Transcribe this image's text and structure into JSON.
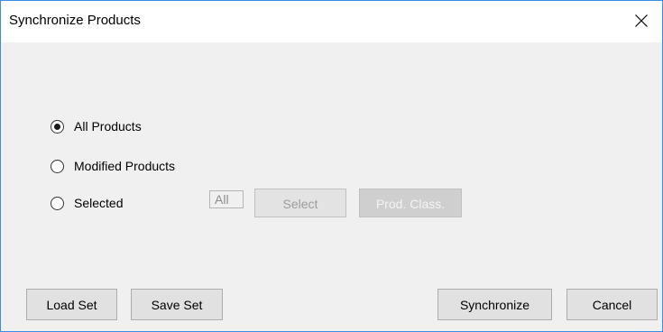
{
  "window": {
    "title": "Synchronize Products"
  },
  "options": {
    "all_products": {
      "label": "All Products",
      "checked": true
    },
    "modified_products": {
      "label": "Modified Products",
      "checked": false
    },
    "selected": {
      "label": "Selected",
      "checked": false
    }
  },
  "selection": {
    "field_value": "All",
    "select_label": "Select",
    "prod_class_label": "Prod. Class."
  },
  "footer": {
    "load_set_label": "Load Set",
    "save_set_label": "Save Set",
    "synchronize_label": "Synchronize",
    "cancel_label": "Cancel"
  },
  "icons": {
    "close": "close-icon"
  },
  "colors": {
    "window_border": "#3a8ee6",
    "titlebar_bg": "#ffffff",
    "client_bg": "#f0f0f0",
    "button_bg": "#e1e1e1"
  }
}
